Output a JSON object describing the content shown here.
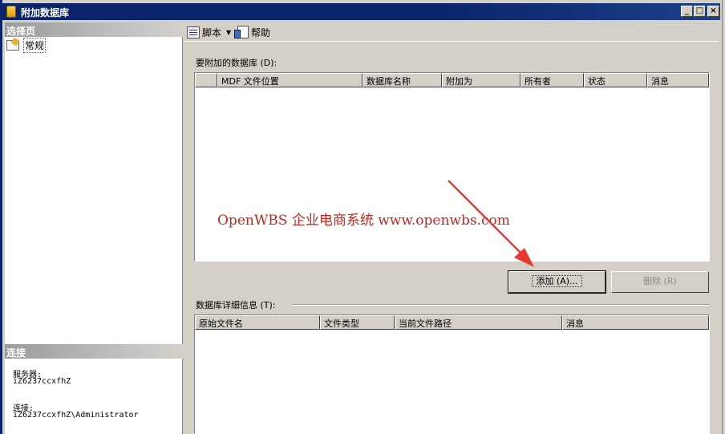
{
  "window": {
    "title": "附加数据库"
  },
  "left_pane": {
    "select_page_header": "选择页",
    "pages": [
      {
        "label": "常规"
      }
    ],
    "connection_header": "连接",
    "server_label": "服务器:",
    "server_value": "iZ6237ccxfhZ",
    "connection_label": "连接:",
    "connection_value": "iZ6237ccxfhZ\\Administrator"
  },
  "toolbar": {
    "script_label": "脚本",
    "help_label": "帮助"
  },
  "attach_section": {
    "label": "要附加的数据库 (D):",
    "columns": [
      "",
      "MDF 文件位置",
      "数据库名称",
      "附加为",
      "所有者",
      "状态",
      "消息"
    ],
    "rows": [],
    "add_button": "添加 (A)...",
    "remove_button": "删除 (R)"
  },
  "detail_section": {
    "label": "数据库详细信息 (T):",
    "columns": [
      "原始文件名",
      "文件类型",
      "当前文件路径",
      "消息"
    ],
    "rows": []
  },
  "watermark": "OpenWBS 企业电商系统 www.openwbs.com",
  "colors": {
    "titlebar": "#0a246a",
    "watermark": "#c8261e",
    "arrow": "#e8392f"
  }
}
